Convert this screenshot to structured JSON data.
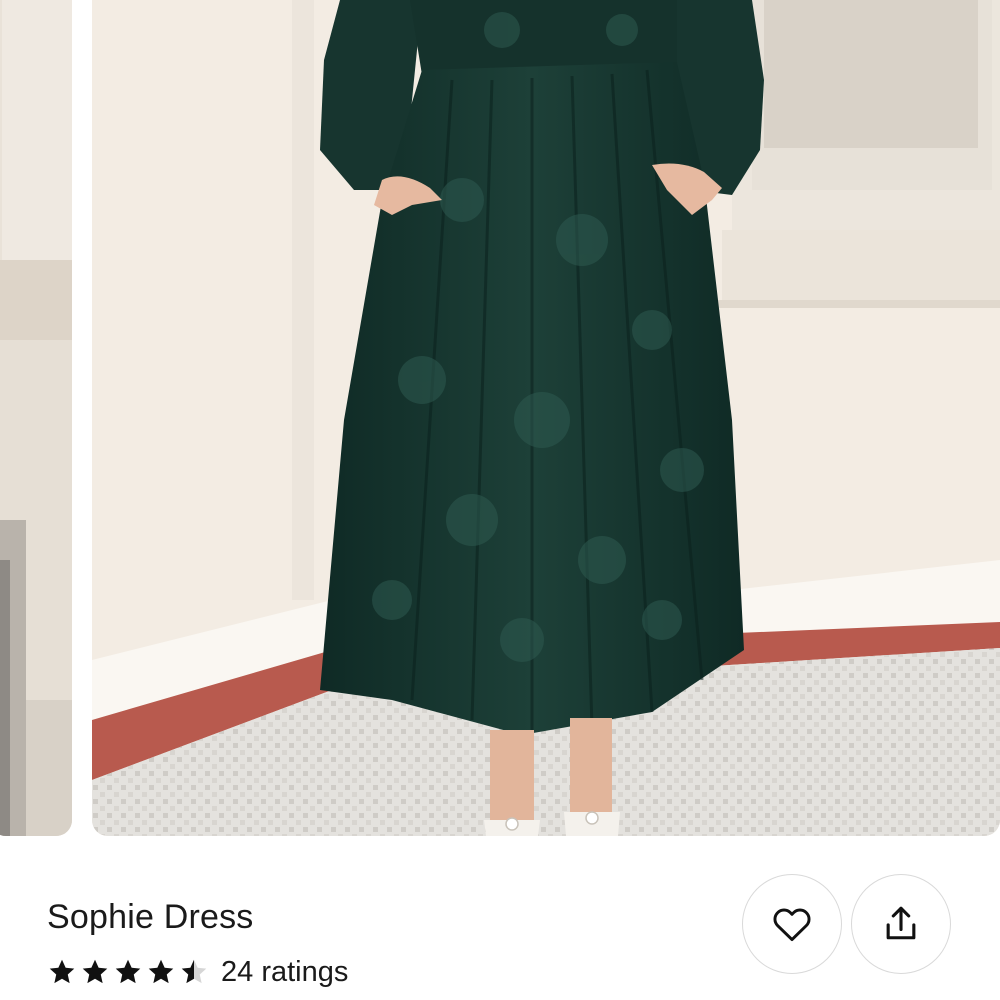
{
  "carousel": {
    "images": [
      {
        "alt": "previous product photo"
      },
      {
        "alt": "Sophie Dress product photo"
      }
    ]
  },
  "product": {
    "title": "Sophie Dress",
    "rating": 4.5,
    "rating_max": 5,
    "ratings_label": "24 ratings"
  },
  "actions": {
    "favorite_icon": "heart-icon",
    "share_icon": "share-icon"
  },
  "colors": {
    "dress": "#16342e",
    "wall": "#f3ece3",
    "tile_border": "#b85a4e",
    "star": "#111111"
  }
}
